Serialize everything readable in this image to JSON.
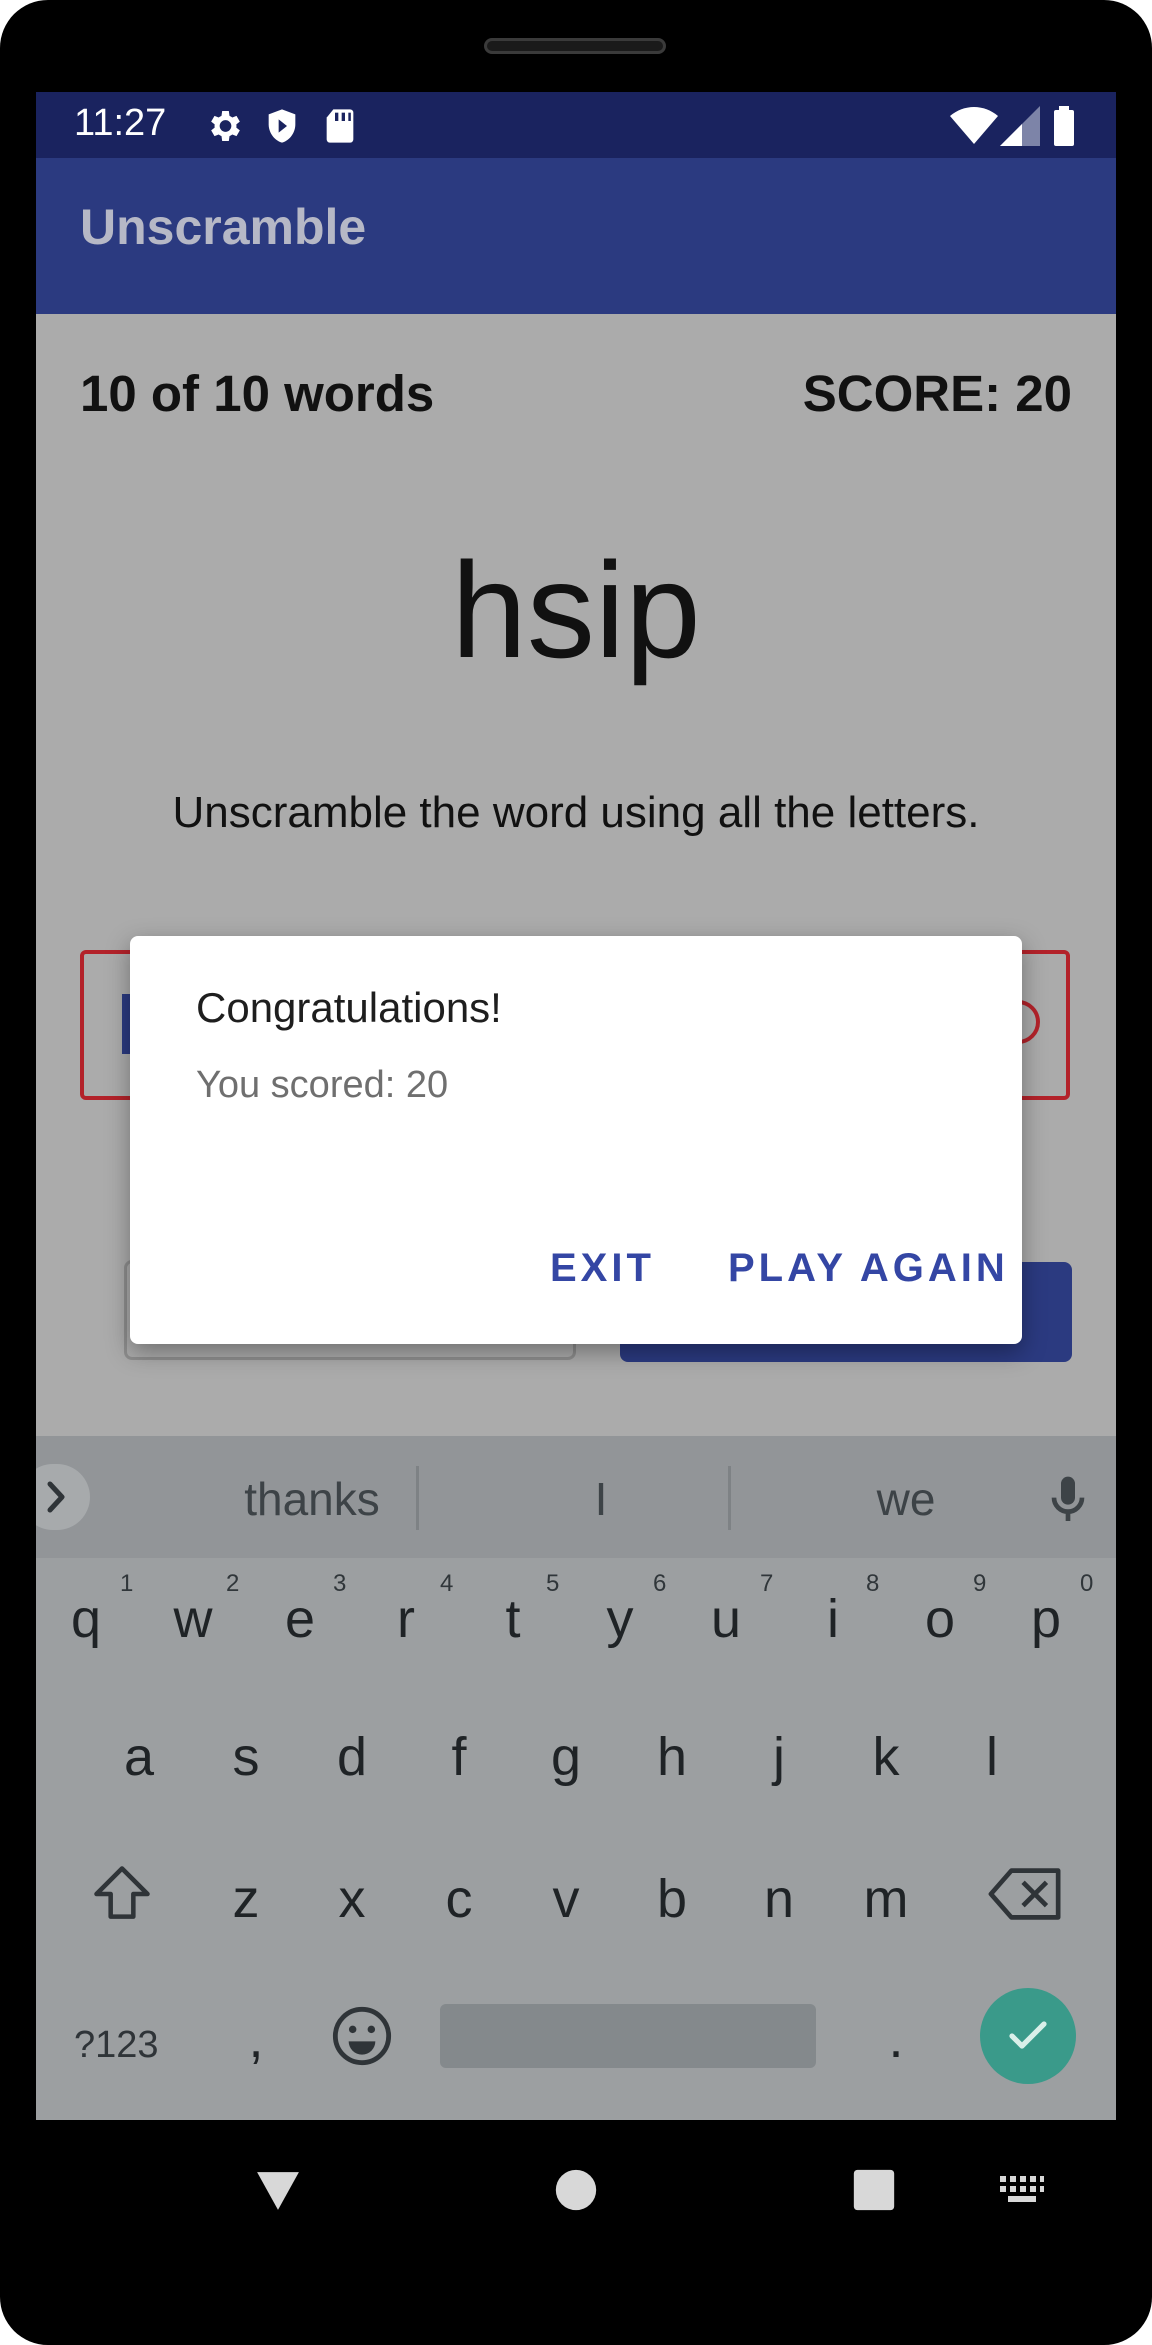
{
  "status_bar": {
    "time": "11:27",
    "left_icons": [
      "settings-icon",
      "shield-icon",
      "sd-card-icon"
    ],
    "right_icons": [
      "wifi-icon",
      "signal-icon",
      "battery-icon"
    ]
  },
  "app_bar": {
    "title": "Unscramble"
  },
  "game": {
    "word_count": "10 of 10 words",
    "score": "SCORE: 20",
    "scrambled_word": "hsip",
    "instructions": "Unscramble the word using all the letters."
  },
  "dialog": {
    "title": "Congratulations!",
    "message": "You scored: 20",
    "exit_label": "EXIT",
    "play_again_label": "PLAY AGAIN"
  },
  "keyboard": {
    "suggestions": [
      "thanks",
      "I",
      "we"
    ],
    "row1": [
      "q",
      "w",
      "e",
      "r",
      "t",
      "y",
      "u",
      "i",
      "o",
      "p"
    ],
    "row1_hints": [
      "1",
      "2",
      "3",
      "4",
      "5",
      "6",
      "7",
      "8",
      "9",
      "0"
    ],
    "row2": [
      "a",
      "s",
      "d",
      "f",
      "g",
      "h",
      "j",
      "k",
      "l"
    ],
    "row3": [
      "z",
      "x",
      "c",
      "v",
      "b",
      "n",
      "m"
    ],
    "symbols_label": "?123",
    "comma_label": ",",
    "period_label": ".",
    "accent_color": "#3a9a8a"
  },
  "nav_bar": {
    "icons": [
      "back-icon",
      "home-icon",
      "recents-icon",
      "keyboard-switch-icon"
    ]
  }
}
